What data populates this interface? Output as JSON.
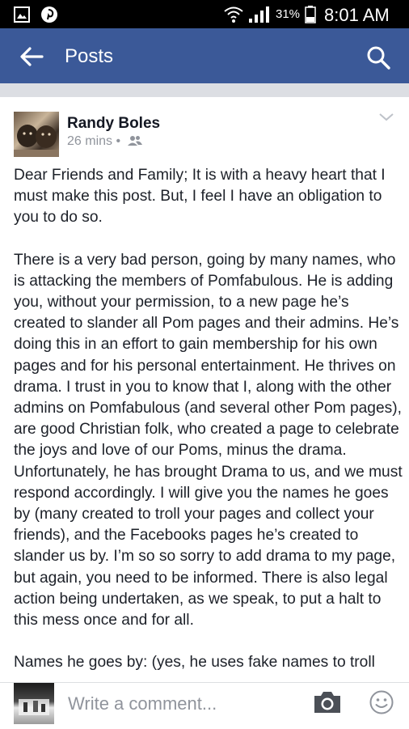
{
  "status_bar": {
    "battery_percent": "31%",
    "time": "8:01 AM",
    "icons": [
      "gallery-icon",
      "pinterest-icon",
      "wifi-icon",
      "signal-icon",
      "battery-icon"
    ]
  },
  "app_bar": {
    "title": "Posts",
    "back_icon": "arrow-left-icon",
    "search_icon": "search-icon",
    "background": "#3b5998"
  },
  "post": {
    "author": "Randy Boles",
    "time": "26 mins",
    "separator": "•",
    "audience_icon": "friends-icon",
    "menu_icon": "chevron-down-icon",
    "paragraphs": [
      "Dear Friends and Family; It is with a heavy heart that I must make this post.  But, I feel I have an obligation to you to do so.",
      "There is a very bad person, going by many names, who is attacking the members of Pomfabulous.  He is adding you, without your permission, to a new page he’s created to slander all Pom pages and their admins.  He’s doing this in an effort to gain membership for his own pages and for his personal entertainment.  He thrives on drama.  I trust in you to know that I, along with the other admins on Pomfabulous (and several other Pom pages), are good Christian folk, who created a page to celebrate the joys and love of our Poms, minus the drama. Unfortunately, he has brought Drama to us, and we must respond accordingly.  I will give you the names he goes by (many created to troll your pages and collect your friends), and the Facebooks pages he’s created to slander us by.  I’m so so sorry to add drama to my page, but again, you need to be informed. There is also legal action being undertaken, as we speak, to put a halt to this mess once and for all.",
      "Names he goes by: (yes, he uses fake names to troll"
    ]
  },
  "composer": {
    "placeholder": "Write a comment...",
    "camera_icon": "camera-icon",
    "emoji_icon": "smiley-icon"
  }
}
